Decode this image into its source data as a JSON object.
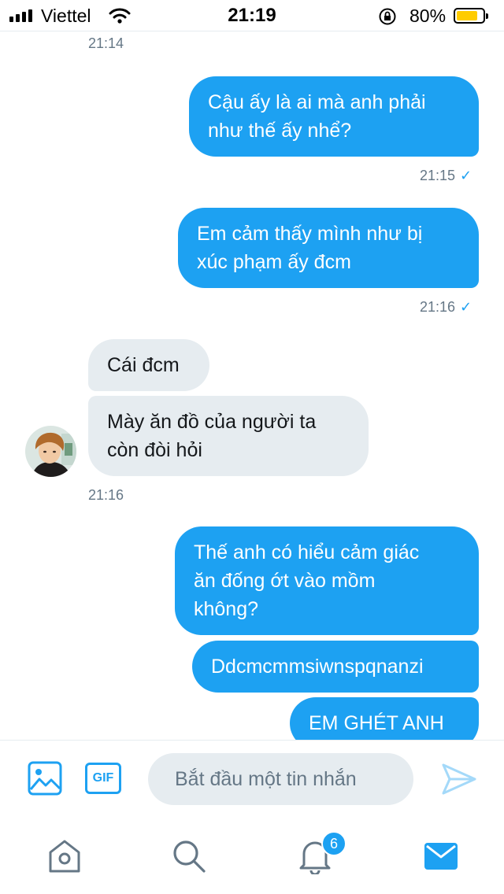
{
  "status_bar": {
    "carrier": "Viettel",
    "time": "21:19",
    "battery_percent": "80%",
    "battery_level": 0.8,
    "battery_color": "#ffcc00",
    "icons": [
      "signal-icon",
      "wifi-icon",
      "orientation-lock-icon",
      "battery-icon"
    ]
  },
  "conversation": {
    "top_timestamp": "21:14",
    "messages": [
      {
        "direction": "outgoing",
        "lines": [
          "Cậu ấy là ai mà anh phải",
          "như thế ấy nhể?"
        ]
      },
      {
        "direction": "outgoing",
        "lines": [
          "Em cảm thấy mình như bị",
          "xúc phạm ấy đcm"
        ]
      },
      {
        "direction": "incoming",
        "lines": [
          "Cái đcm"
        ]
      },
      {
        "direction": "incoming",
        "lines": [
          "Mày ăn đồ của người ta",
          "còn đòi hỏi"
        ]
      },
      {
        "direction": "outgoing",
        "lines": [
          "Thế anh có hiểu cảm giác",
          "ăn đống ớt vào mồm",
          "không?"
        ]
      },
      {
        "direction": "outgoing",
        "lines": [
          "Ddcmcmmsiwnspqnanzi"
        ]
      },
      {
        "direction": "outgoing",
        "lines": [
          "EM GHÉT ANH"
        ]
      }
    ],
    "timestamps": {
      "after_message_1": {
        "time": "21:15",
        "check": "✓"
      },
      "after_message_2": {
        "time": "21:16",
        "check": "✓"
      },
      "after_message_4": {
        "time": "21:16"
      }
    }
  },
  "composer": {
    "image_button_icon": "image-icon",
    "gif_label": "GIF",
    "placeholder": "Bắt đầu một tin nhắn",
    "value": "",
    "send_icon": "send-icon"
  },
  "tab_bar": {
    "tabs": [
      {
        "name": "home",
        "icon": "home-icon"
      },
      {
        "name": "search",
        "icon": "search-icon"
      },
      {
        "name": "notifications",
        "icon": "bell-icon",
        "badge": "6"
      },
      {
        "name": "messages",
        "icon": "mail-icon",
        "active": true
      }
    ]
  },
  "colors": {
    "accent": "#1da1f2",
    "incoming_bubble": "#e6ecf0",
    "muted_text": "#657786",
    "inactive_icon": "#657786"
  }
}
